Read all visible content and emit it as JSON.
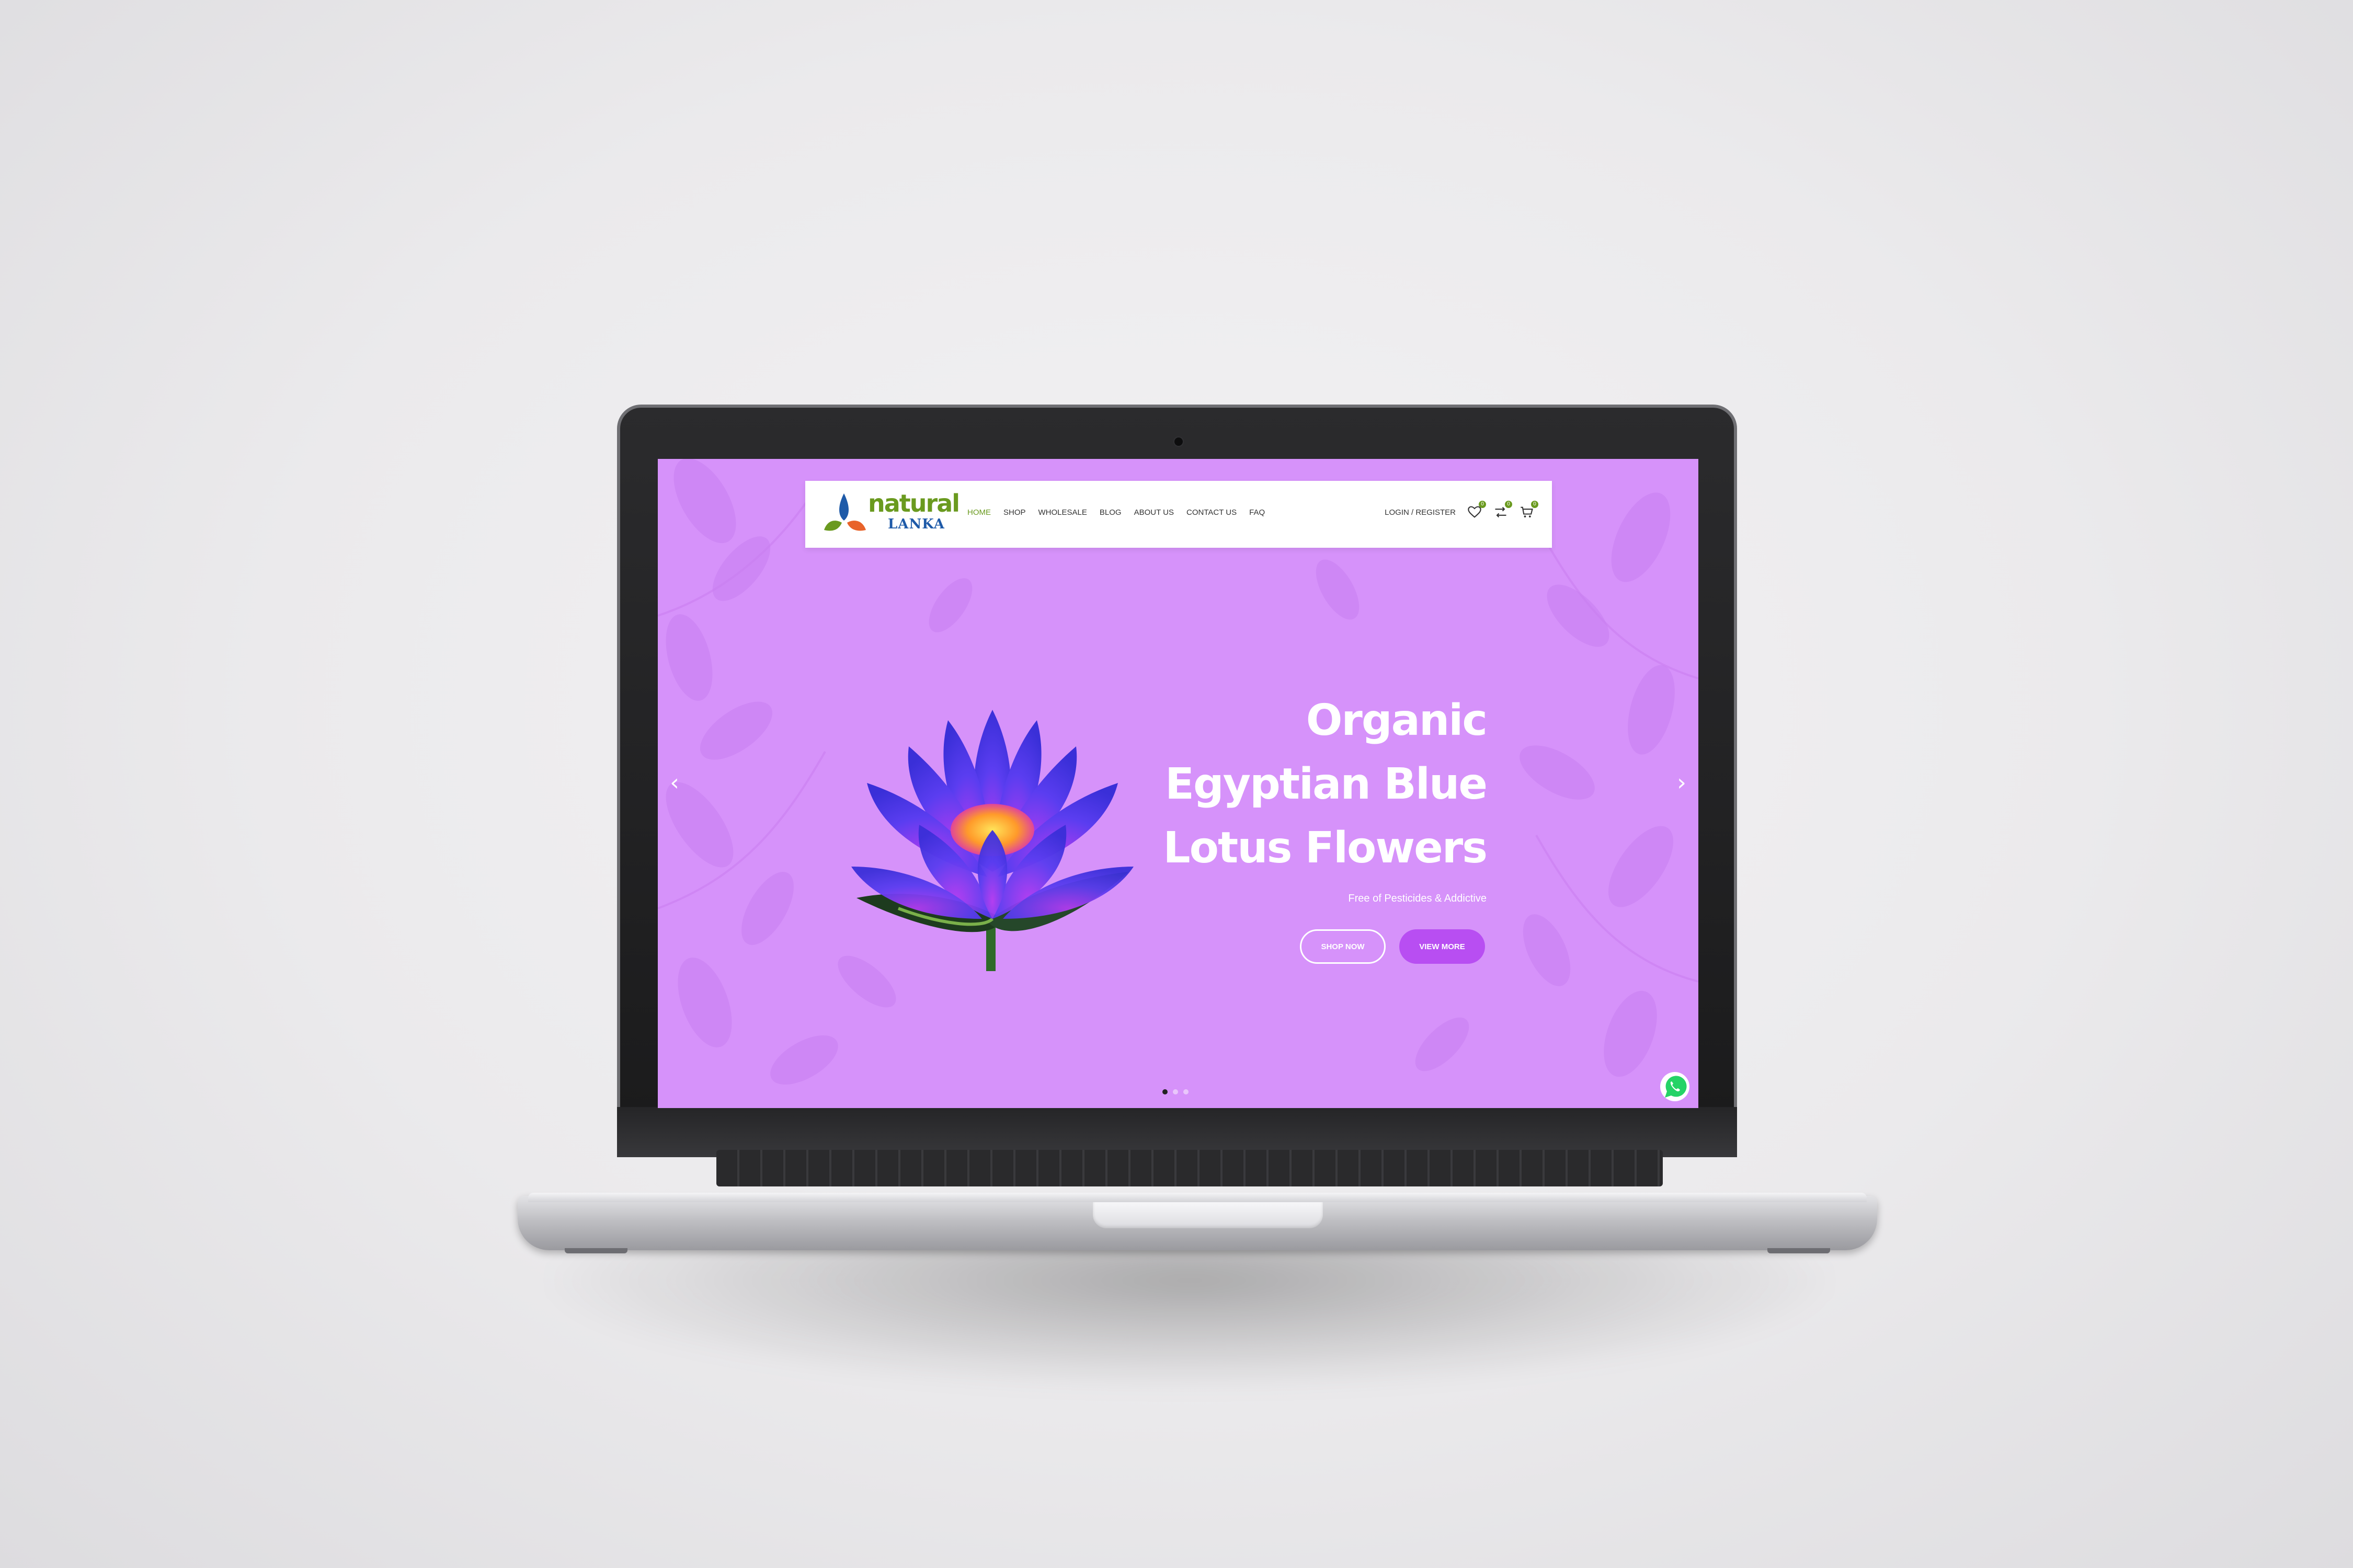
{
  "site": {
    "logo": {
      "word1": "natural",
      "word2": "LANKA"
    },
    "nav": [
      {
        "label": "HOME",
        "active": true
      },
      {
        "label": "SHOP",
        "active": false
      },
      {
        "label": "WHOLESALE",
        "active": false
      },
      {
        "label": "BLOG",
        "active": false
      },
      {
        "label": "ABOUT US",
        "active": false
      },
      {
        "label": "CONTACT US",
        "active": false
      },
      {
        "label": "FAQ",
        "active": false
      }
    ],
    "header_right": {
      "login_label": "LOGIN / REGISTER",
      "wishlist_count": "0",
      "compare_count": "0",
      "cart_count": "0"
    },
    "colors": {
      "hero_background": "#d692fa",
      "brand_green": "#6a9a1f",
      "brand_blue": "#1e5aa8",
      "view_more_button": "#b84ef2"
    }
  },
  "hero": {
    "title_lines": [
      "Organic",
      "Egyptian Blue",
      "Lotus Flowers"
    ],
    "subtitle": "Free of Pesticides & Addictive",
    "primary_button": "SHOP NOW",
    "secondary_button": "VIEW MORE",
    "prev_arrow": "‹",
    "next_arrow": "›",
    "slides_total": 3,
    "active_slide": 1
  },
  "icons": [
    "heart-icon",
    "compare-icon",
    "cart-icon",
    "whatsapp-icon",
    "lotus-flower-image",
    "leaf-pattern"
  ]
}
